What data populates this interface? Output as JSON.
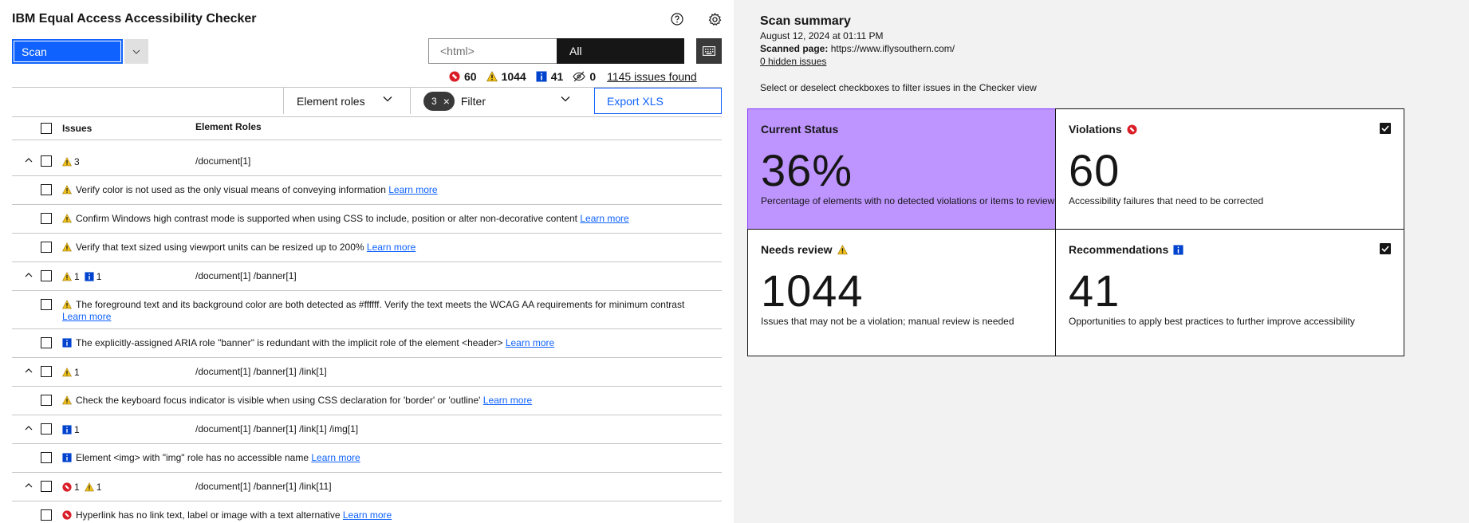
{
  "header": {
    "title": "IBM Equal Access Accessibility Checker",
    "help_icon": "help-icon",
    "settings_icon": "gear-icon"
  },
  "controls": {
    "scan_label": "Scan",
    "search_value": "<html>",
    "view_select": "All",
    "keyboard_icon": "keyboard-icon"
  },
  "counts": {
    "violations": "60",
    "needs_review": "1044",
    "recommendations": "41",
    "hidden": "0",
    "issues_found": "1145 issues found"
  },
  "toolbar": {
    "element_roles": "Element roles",
    "filter_count": "3",
    "filter_label": "Filter",
    "export_label": "Export XLS"
  },
  "table": {
    "col_issues": "Issues",
    "col_roles": "Element Roles"
  },
  "rows": [
    {
      "type": "group",
      "badges": [
        {
          "kind": "review",
          "n": "3"
        }
      ],
      "path": "/document[1]"
    },
    {
      "type": "issue",
      "kind": "review",
      "text": "Verify color is not used as the only visual means of conveying information",
      "link": "Learn more"
    },
    {
      "type": "issue",
      "kind": "review",
      "text": "Confirm Windows high contrast mode is supported when using CSS to include, position or alter non-decorative content",
      "link": "Learn more"
    },
    {
      "type": "issue",
      "kind": "review",
      "text": "Verify that text sized using viewport units can be resized up to 200%",
      "link": "Learn more"
    },
    {
      "type": "group",
      "badges": [
        {
          "kind": "review",
          "n": "1"
        },
        {
          "kind": "rec",
          "n": "1"
        }
      ],
      "path": "/document[1] /banner[1]"
    },
    {
      "type": "issue",
      "kind": "review",
      "tall": true,
      "text": "The foreground text and its background color are both detected as #ffffff. Verify the text meets the WCAG AA requirements for minimum contrast",
      "link": "Learn more"
    },
    {
      "type": "issue",
      "kind": "rec",
      "text": "The explicitly-assigned ARIA role \"banner\" is redundant with the implicit role of the element <header>",
      "link": "Learn more"
    },
    {
      "type": "group",
      "badges": [
        {
          "kind": "review",
          "n": "1"
        }
      ],
      "path": "/document[1] /banner[1] /link[1]"
    },
    {
      "type": "issue",
      "kind": "review",
      "text": "Check the keyboard focus indicator is visible when using CSS declaration for 'border' or 'outline'",
      "link": "Learn more"
    },
    {
      "type": "group",
      "badges": [
        {
          "kind": "rec",
          "n": "1"
        }
      ],
      "path": "/document[1] /banner[1] /link[1] /img[1]"
    },
    {
      "type": "issue",
      "kind": "rec",
      "text": "Element <img> with \"img\" role has no accessible name",
      "link": "Learn more"
    },
    {
      "type": "group",
      "badges": [
        {
          "kind": "violation",
          "n": "1"
        },
        {
          "kind": "review",
          "n": "1"
        }
      ],
      "path": "/document[1] /banner[1] /link[11]"
    },
    {
      "type": "issue",
      "kind": "violation",
      "text": "Hyperlink has no link text, label or image with a text alternative",
      "link": "Learn more"
    }
  ],
  "summary": {
    "title": "Scan summary",
    "date": "August 12, 2024 at 01:11 PM",
    "scanned_label": "Scanned page:",
    "scanned_url": "https://www.iflysouthern.com/",
    "hidden": "0 hidden issues",
    "instructions": "Select or deselect checkboxes to filter issues in the Checker view"
  },
  "tiles": [
    {
      "key": "current",
      "title": "Current Status",
      "value": "36%",
      "desc": "Percentage of elements with no detected violations or items to review",
      "icon": "",
      "checkbox": false
    },
    {
      "key": "violations",
      "title": "Violations",
      "value": "60",
      "desc": "Accessibility failures that need to be corrected",
      "icon": "violation-icon",
      "checkbox": true
    },
    {
      "key": "review",
      "title": "Needs review",
      "value": "1044",
      "desc": "Issues that may not be a violation; manual review is needed",
      "icon": "needs-review-icon",
      "checkbox": true
    },
    {
      "key": "recommendations",
      "title": "Recommendations",
      "value": "41",
      "desc": "Opportunities to apply best practices to further improve accessibility",
      "icon": "recommendation-icon",
      "checkbox": true
    }
  ],
  "colors": {
    "primary": "#0f62fe",
    "violation": "#da1e28",
    "review": "#f1c21b",
    "recommendation": "#0043ce",
    "current_status_bg": "#be95ff"
  }
}
